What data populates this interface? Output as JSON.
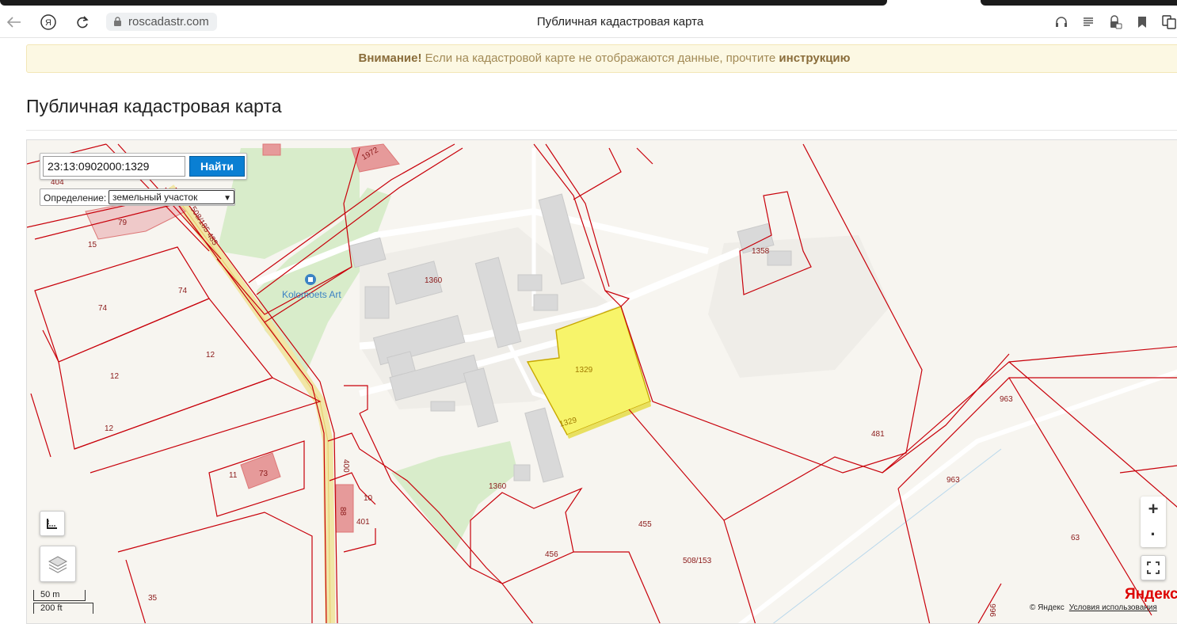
{
  "browser": {
    "url": "roscadastr.com",
    "tab_title": "Публичная кадастровая карта"
  },
  "notice": {
    "bold": "Внимание!",
    "text": " Если на кадастровой карте не отображаются данные, прочтите ",
    "link": "инструкцию"
  },
  "page": {
    "title": "Публичная кадастровая карта"
  },
  "map": {
    "search_value": "23:13:0902000:1329",
    "search_button": "Найти",
    "definition_label": "Определение:",
    "definition_selected": "земельный участок",
    "poi_name": "Kolomoets Art",
    "scale_metric": "50 m",
    "scale_imperial": "200 ft",
    "yandex_logo": "Яндекс",
    "copyright": "© Яндекс",
    "terms_link": "Условия использования",
    "highlight_color": "#f7f46a",
    "parcel_border_color": "#c8000a",
    "parcels": [
      "1972",
      "404",
      "79",
      "15",
      "74",
      "12",
      "12",
      "12",
      "508/185 485",
      "1360",
      "1358",
      "1329",
      "1329",
      "400",
      "10",
      "88",
      "401",
      "11",
      "73",
      "1360",
      "456",
      "455",
      "508/153",
      "481",
      "963",
      "963",
      "63",
      "966",
      "35"
    ]
  }
}
